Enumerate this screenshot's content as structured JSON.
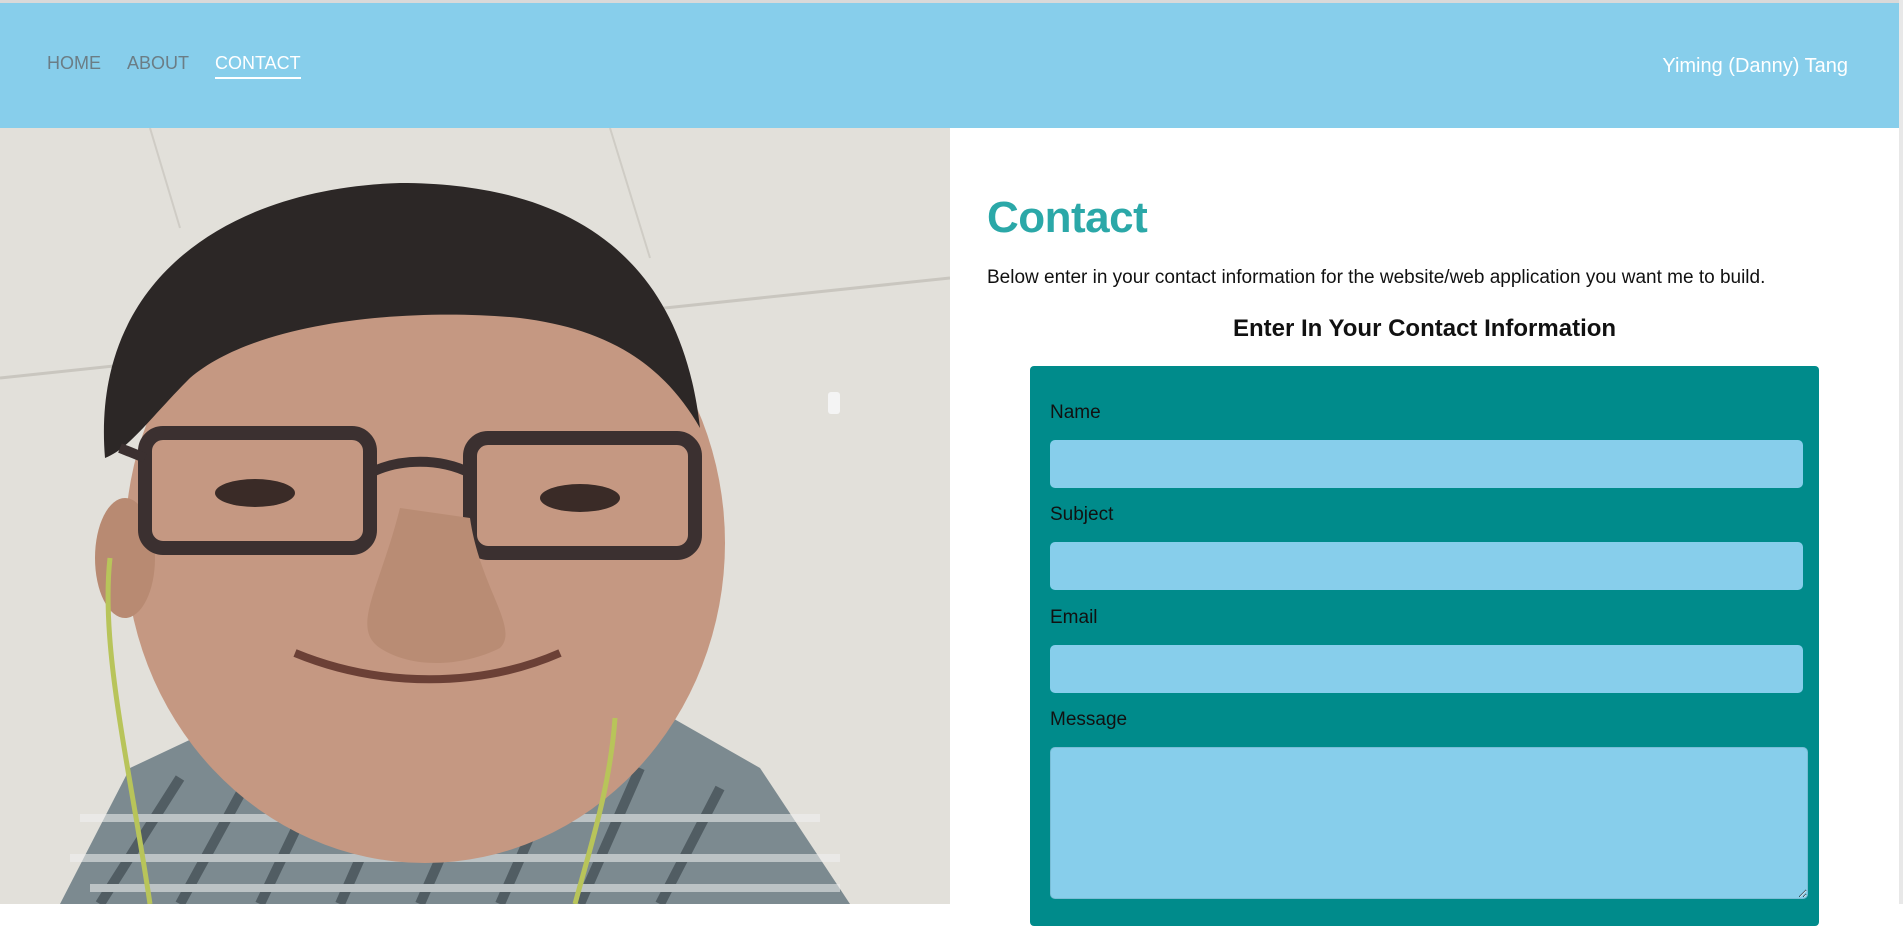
{
  "nav": {
    "items": [
      {
        "label": "HOME"
      },
      {
        "label": "ABOUT"
      },
      {
        "label": "CONTACT"
      }
    ],
    "brand": "Yiming (Danny) Tang"
  },
  "main": {
    "title": "Contact",
    "intro": "Below enter in your contact information for the website/web application you want me to build.",
    "form_heading": "Enter In Your Contact Information",
    "form": {
      "name_label": "Name",
      "name_value": "",
      "subject_label": "Subject",
      "subject_value": "",
      "email_label": "Email",
      "email_value": "",
      "message_label": "Message",
      "message_value": ""
    }
  },
  "colors": {
    "header_bg": "#87ceeb",
    "title": "#2ba8a8",
    "form_bg": "#008b8b",
    "input_bg": "#87ceeb"
  }
}
